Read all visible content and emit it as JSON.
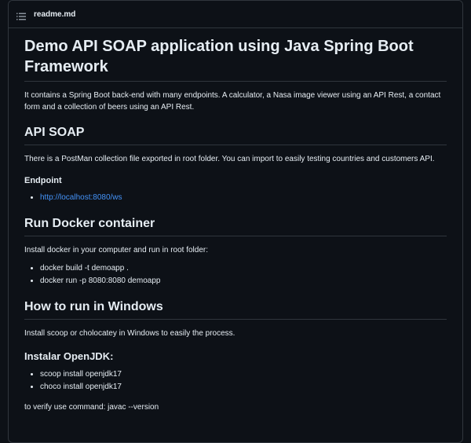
{
  "file": {
    "name": "readme.md",
    "icon": "list-icon"
  },
  "title": "Demo API SOAP application using Java Spring Boot Framework",
  "intro": "It contains a Spring Boot back-end with many endpoints. A calculator, a Nasa image viewer using an API Rest, a contact form and a collection of beers using an API Rest.",
  "api_soap": {
    "heading": "API SOAP",
    "text": "There is a PostMan collection file exported in root folder. You can import to easily testing countries and customers API.",
    "endpoint_heading": "Endpoint",
    "endpoint_link": "http://localhost:8080/ws"
  },
  "docker": {
    "heading": "Run Docker container",
    "text": "Install docker in your computer and run in root folder:",
    "commands": [
      "docker build -t demoapp .",
      "docker run -p 8080:8080 demoapp"
    ]
  },
  "windows": {
    "heading": "How to run in Windows",
    "text": "Install scoop or cholocatey in Windows to easily the process.",
    "jdk_heading": "Instalar OpenJDK:",
    "commands": [
      "scoop install openjdk17",
      "choco install openjdk17"
    ],
    "verify": "to verify use command: javac --version"
  },
  "colors": {
    "background": "#0d1117",
    "border": "#30363d",
    "link": "#4493f8",
    "text": "#e6edf3"
  }
}
